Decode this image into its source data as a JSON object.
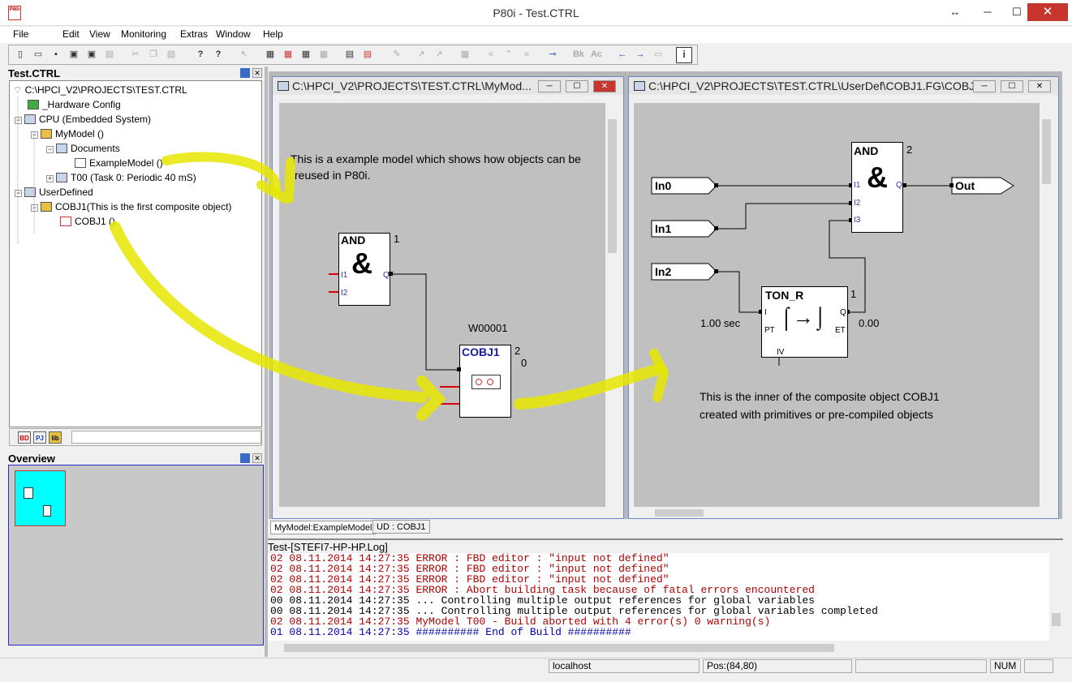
{
  "window": {
    "title": "P80i - Test.CTRL",
    "app_icon": "P80i",
    "btn_restore": "↔",
    "btn_min": "─",
    "btn_max": "☐",
    "btn_close": "✕"
  },
  "menu": [
    "File",
    "Edit",
    "View",
    "Monitoring",
    "Extras",
    "Window",
    "Help"
  ],
  "toolbar": {
    "bk": "Bk",
    "ac": "Ac",
    "info": "i",
    "help": "?",
    "context_help": "?"
  },
  "tree_panel": {
    "title": "Test.CTRL",
    "items": [
      "C:\\HPCI_V2\\PROJECTS\\TEST.CTRL",
      "_Hardware Config",
      "CPU (Embedded System)",
      "MyModel ()",
      "Documents",
      "ExampleModel ()",
      "T00  (Task 0: Periodic 40 mS)",
      "UserDefined",
      "COBJ1(This is the first composite object)",
      "COBJ1 ()"
    ],
    "tabs": [
      "BD",
      "PJ",
      "lib"
    ]
  },
  "overview": {
    "title": "Overview"
  },
  "left_window": {
    "title": "C:\\HPCI_V2\\PROJECTS\\TEST.CTRL\\MyMod...",
    "comment_line1": "This is a example model which shows how objects can be",
    "comment_line2": "reused in P80i.",
    "and_block": {
      "name": "AND",
      "number": "1",
      "symbol": "&",
      "in1": "I1",
      "in2": "I2",
      "out": "Q"
    },
    "cobj_block": {
      "instance": "W00001",
      "name": "COBJ1",
      "number": "2",
      "value": "0"
    }
  },
  "right_window": {
    "title": "C:\\HPCI_V2\\PROJECTS\\TEST.CTRL\\UserDef\\COBJ1.FG\\COBJ1",
    "inputs": [
      "In0",
      "In1",
      "In2"
    ],
    "output": "Out",
    "and_block": {
      "name": "AND",
      "number": "2",
      "symbol": "&",
      "in1": "I1",
      "in2": "I2",
      "in3": "I3",
      "out": "Q"
    },
    "ton_block": {
      "name": "TON_R",
      "number": "1",
      "in_i": "I",
      "in_pt": "PT",
      "in_iv": "IV",
      "out_q": "Q",
      "out_et": "ET",
      "pt_value": "1.00 sec",
      "et_value": "0.00"
    },
    "comment_line1": "This is the inner of the composite object COBJ1",
    "comment_line2": "created with primitives or pre-compiled objects"
  },
  "doc_tabs": [
    "MyModel:ExampleModel",
    "UD : COBJ1"
  ],
  "log": {
    "title": "Test-[STEFI7-HP-HP.Log]",
    "lines": [
      {
        "code": "02",
        "text": "08.11.2014 14:27:35 ERROR : FBD editor : \"input not defined\"",
        "kind": "err"
      },
      {
        "code": "02",
        "text": "08.11.2014 14:27:35 ERROR : FBD editor : \"input not defined\"",
        "kind": "err"
      },
      {
        "code": "02",
        "text": "08.11.2014 14:27:35 ERROR : FBD editor : \"input not defined\"",
        "kind": "err"
      },
      {
        "code": "02",
        "text": "08.11.2014 14:27:35 ERROR : Abort building task because of fatal errors encountered",
        "kind": "err"
      },
      {
        "code": "00",
        "text": "08.11.2014 14:27:35 ... Controlling multiple output references for global variables",
        "kind": "ok"
      },
      {
        "code": "00",
        "text": "08.11.2014 14:27:35 ... Controlling multiple output references for global variables completed",
        "kind": "ok"
      },
      {
        "code": "02",
        "text": "08.11.2014 14:27:35 MyModel T00 - Build aborted with 4 error(s) 0 warning(s)",
        "kind": "err"
      },
      {
        "code": "01",
        "text": "08.11.2014 14:27:35 ########## End of Build ##########",
        "kind": "info"
      }
    ]
  },
  "status": {
    "host": "localhost",
    "pos": "Pos:(84,80)",
    "num": "NUM"
  },
  "colors": {
    "highlight": "#e6e600",
    "canvas": "#c0c0c0",
    "error": "#b00000",
    "info": "#0000b0"
  }
}
